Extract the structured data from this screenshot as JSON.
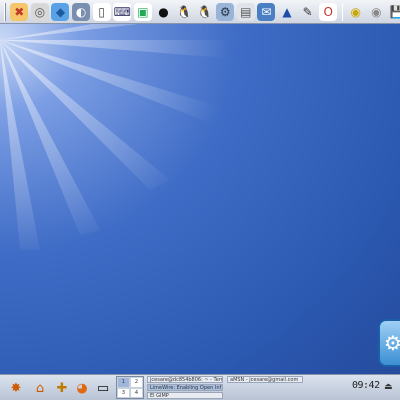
{
  "desktop": {
    "top_launchers": [
      {
        "name": "xmms-icon",
        "glyph": "✖",
        "bg": "#f5c66a",
        "fg": "#c0392b"
      },
      {
        "name": "disc-burner-icon",
        "glyph": "◎",
        "bg": "#d8d8d8",
        "fg": "#555"
      },
      {
        "name": "package-cube-icon",
        "glyph": "◆",
        "bg": "#5aa2e6",
        "fg": "#1d5aa0"
      },
      {
        "name": "globe-browser-icon",
        "glyph": "◐",
        "bg": "#7a8fb0",
        "fg": "#fff"
      },
      {
        "name": "document-icon",
        "glyph": "▯",
        "bg": "#ffffff",
        "fg": "#444"
      },
      {
        "name": "launcher-icon",
        "glyph": "⌨",
        "bg": "#ffffff",
        "fg": "#336"
      },
      {
        "name": "media-player-icon",
        "glyph": "▣",
        "bg": "#ffffff",
        "fg": "#2a5"
      },
      {
        "name": "bomb-game-icon",
        "glyph": "●",
        "bg": "transparent",
        "fg": "#111"
      },
      {
        "name": "tux-icon",
        "glyph": "🐧",
        "bg": "transparent",
        "fg": "#111"
      },
      {
        "name": "penguin-game-icon",
        "glyph": "🐧",
        "bg": "transparent",
        "fg": "#222"
      },
      {
        "name": "network-icon",
        "glyph": "⚙",
        "bg": "#9ab4d8",
        "fg": "#234"
      },
      {
        "name": "printer-icon",
        "glyph": "▤",
        "bg": "#e0e4ea",
        "fg": "#555"
      },
      {
        "name": "mail-icon",
        "glyph": "✉",
        "bg": "#4a7fc4",
        "fg": "#fff"
      },
      {
        "name": "wizard-hat-icon",
        "glyph": "▲",
        "bg": "transparent",
        "fg": "#1d4da8"
      },
      {
        "name": "gimp-icon",
        "glyph": "✎",
        "bg": "transparent",
        "fg": "#333"
      },
      {
        "name": "opera-icon",
        "glyph": "O",
        "bg": "#ffffff",
        "fg": "#c0392b"
      }
    ],
    "top_devices": [
      {
        "name": "cdrom-icon",
        "glyph": "◉",
        "bg": "transparent",
        "fg": "#c9a800"
      },
      {
        "name": "dvd-icon",
        "glyph": "◉",
        "bg": "transparent",
        "fg": "#888"
      },
      {
        "name": "floppy-icon",
        "glyph": "💾",
        "bg": "transparent",
        "fg": "#222"
      }
    ],
    "bottom_launchers": [
      {
        "name": "kmenu-icon",
        "glyph": "✸",
        "fg": "#d05a00"
      },
      {
        "name": "home-icon",
        "glyph": "⌂",
        "fg": "#d05a00"
      },
      {
        "name": "control-center-icon",
        "glyph": "✚",
        "fg": "#c07a00"
      },
      {
        "name": "firefox-icon",
        "glyph": "◕",
        "fg": "#e06a10"
      },
      {
        "name": "terminal-icon",
        "glyph": "▭",
        "fg": "#111"
      }
    ],
    "pager": {
      "desktops": [
        "1",
        "2",
        "3",
        "4"
      ],
      "active_index": 0
    },
    "tasks": [
      {
        "label": "jcesare@dc854b806: ~ - Term",
        "active": false
      },
      {
        "label": "aMSN - jcesare@gmail.com",
        "active": false
      },
      {
        "label": "LimeWire: Enabling Open Inf",
        "active": true
      },
      {
        "label": "El GIMP",
        "active": false
      }
    ],
    "clock": "09:42",
    "tray_glyph": "⏏",
    "side_widget_glyph": "⚙"
  }
}
